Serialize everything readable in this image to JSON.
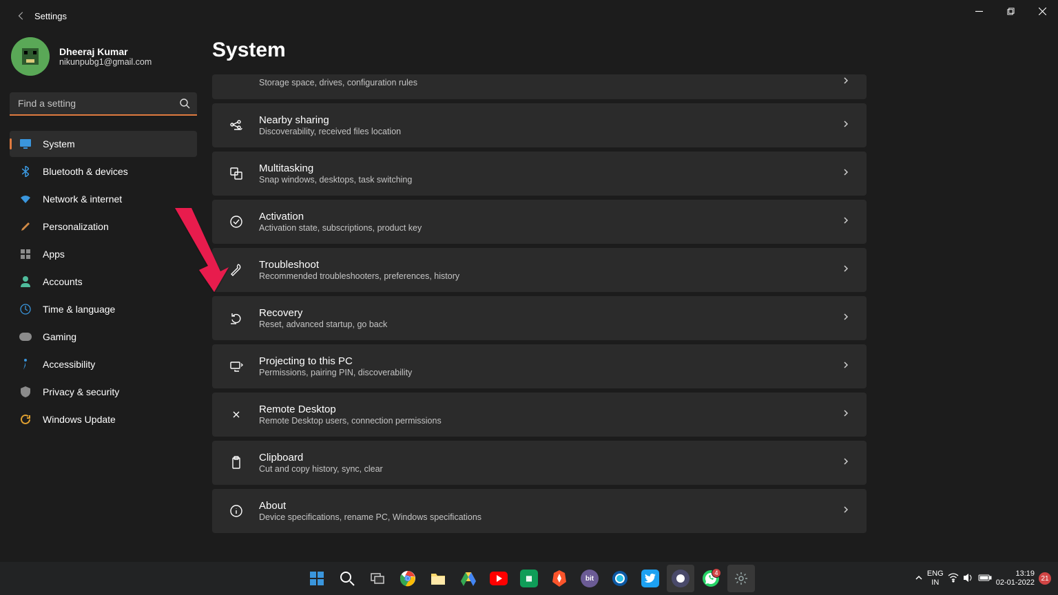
{
  "titlebar": {
    "app": "Settings"
  },
  "profile": {
    "name": "Dheeraj Kumar",
    "email": "nikunpubg1@gmail.com"
  },
  "search": {
    "placeholder": "Find a setting"
  },
  "nav": {
    "items": [
      {
        "label": "System",
        "active": true,
        "icon": "display",
        "color": "#3a96dd"
      },
      {
        "label": "Bluetooth & devices",
        "icon": "bluetooth",
        "color": "#3a96dd"
      },
      {
        "label": "Network & internet",
        "icon": "wifi",
        "color": "#3a96dd"
      },
      {
        "label": "Personalization",
        "icon": "brush",
        "color": "#d08a46"
      },
      {
        "label": "Apps",
        "icon": "grid",
        "color": "#8b8b8b"
      },
      {
        "label": "Accounts",
        "icon": "person",
        "color": "#4fbb9b"
      },
      {
        "label": "Time & language",
        "icon": "globe-clock",
        "color": "#3a96dd"
      },
      {
        "label": "Gaming",
        "icon": "gamepad",
        "color": "#8b8b8b"
      },
      {
        "label": "Accessibility",
        "icon": "accessibility",
        "color": "#3a96dd"
      },
      {
        "label": "Privacy & security",
        "icon": "shield",
        "color": "#8b8b8b"
      },
      {
        "label": "Windows Update",
        "icon": "update",
        "color": "#e0a030"
      }
    ]
  },
  "content": {
    "title": "System",
    "cards": [
      {
        "title": "",
        "sub": "Storage space, drives, configuration rules",
        "icon": "",
        "partial": true
      },
      {
        "title": "Nearby sharing",
        "sub": "Discoverability, received files location",
        "icon": "share"
      },
      {
        "title": "Multitasking",
        "sub": "Snap windows, desktops, task switching",
        "icon": "multitask"
      },
      {
        "title": "Activation",
        "sub": "Activation state, subscriptions, product key",
        "icon": "check-circle"
      },
      {
        "title": "Troubleshoot",
        "sub": "Recommended troubleshooters, preferences, history",
        "icon": "wrench"
      },
      {
        "title": "Recovery",
        "sub": "Reset, advanced startup, go back",
        "icon": "recovery"
      },
      {
        "title": "Projecting to this PC",
        "sub": "Permissions, pairing PIN, discoverability",
        "icon": "project"
      },
      {
        "title": "Remote Desktop",
        "sub": "Remote Desktop users, connection permissions",
        "icon": "remote"
      },
      {
        "title": "Clipboard",
        "sub": "Cut and copy history, sync, clear",
        "icon": "clipboard"
      },
      {
        "title": "About",
        "sub": "Device specifications, rename PC, Windows specifications",
        "icon": "info"
      }
    ]
  },
  "taskbar": {
    "lang1": "ENG",
    "lang2": "IN",
    "time": "13:19",
    "date": "02-01-2022",
    "notif_count": "21",
    "whatsapp_badge": "4"
  }
}
